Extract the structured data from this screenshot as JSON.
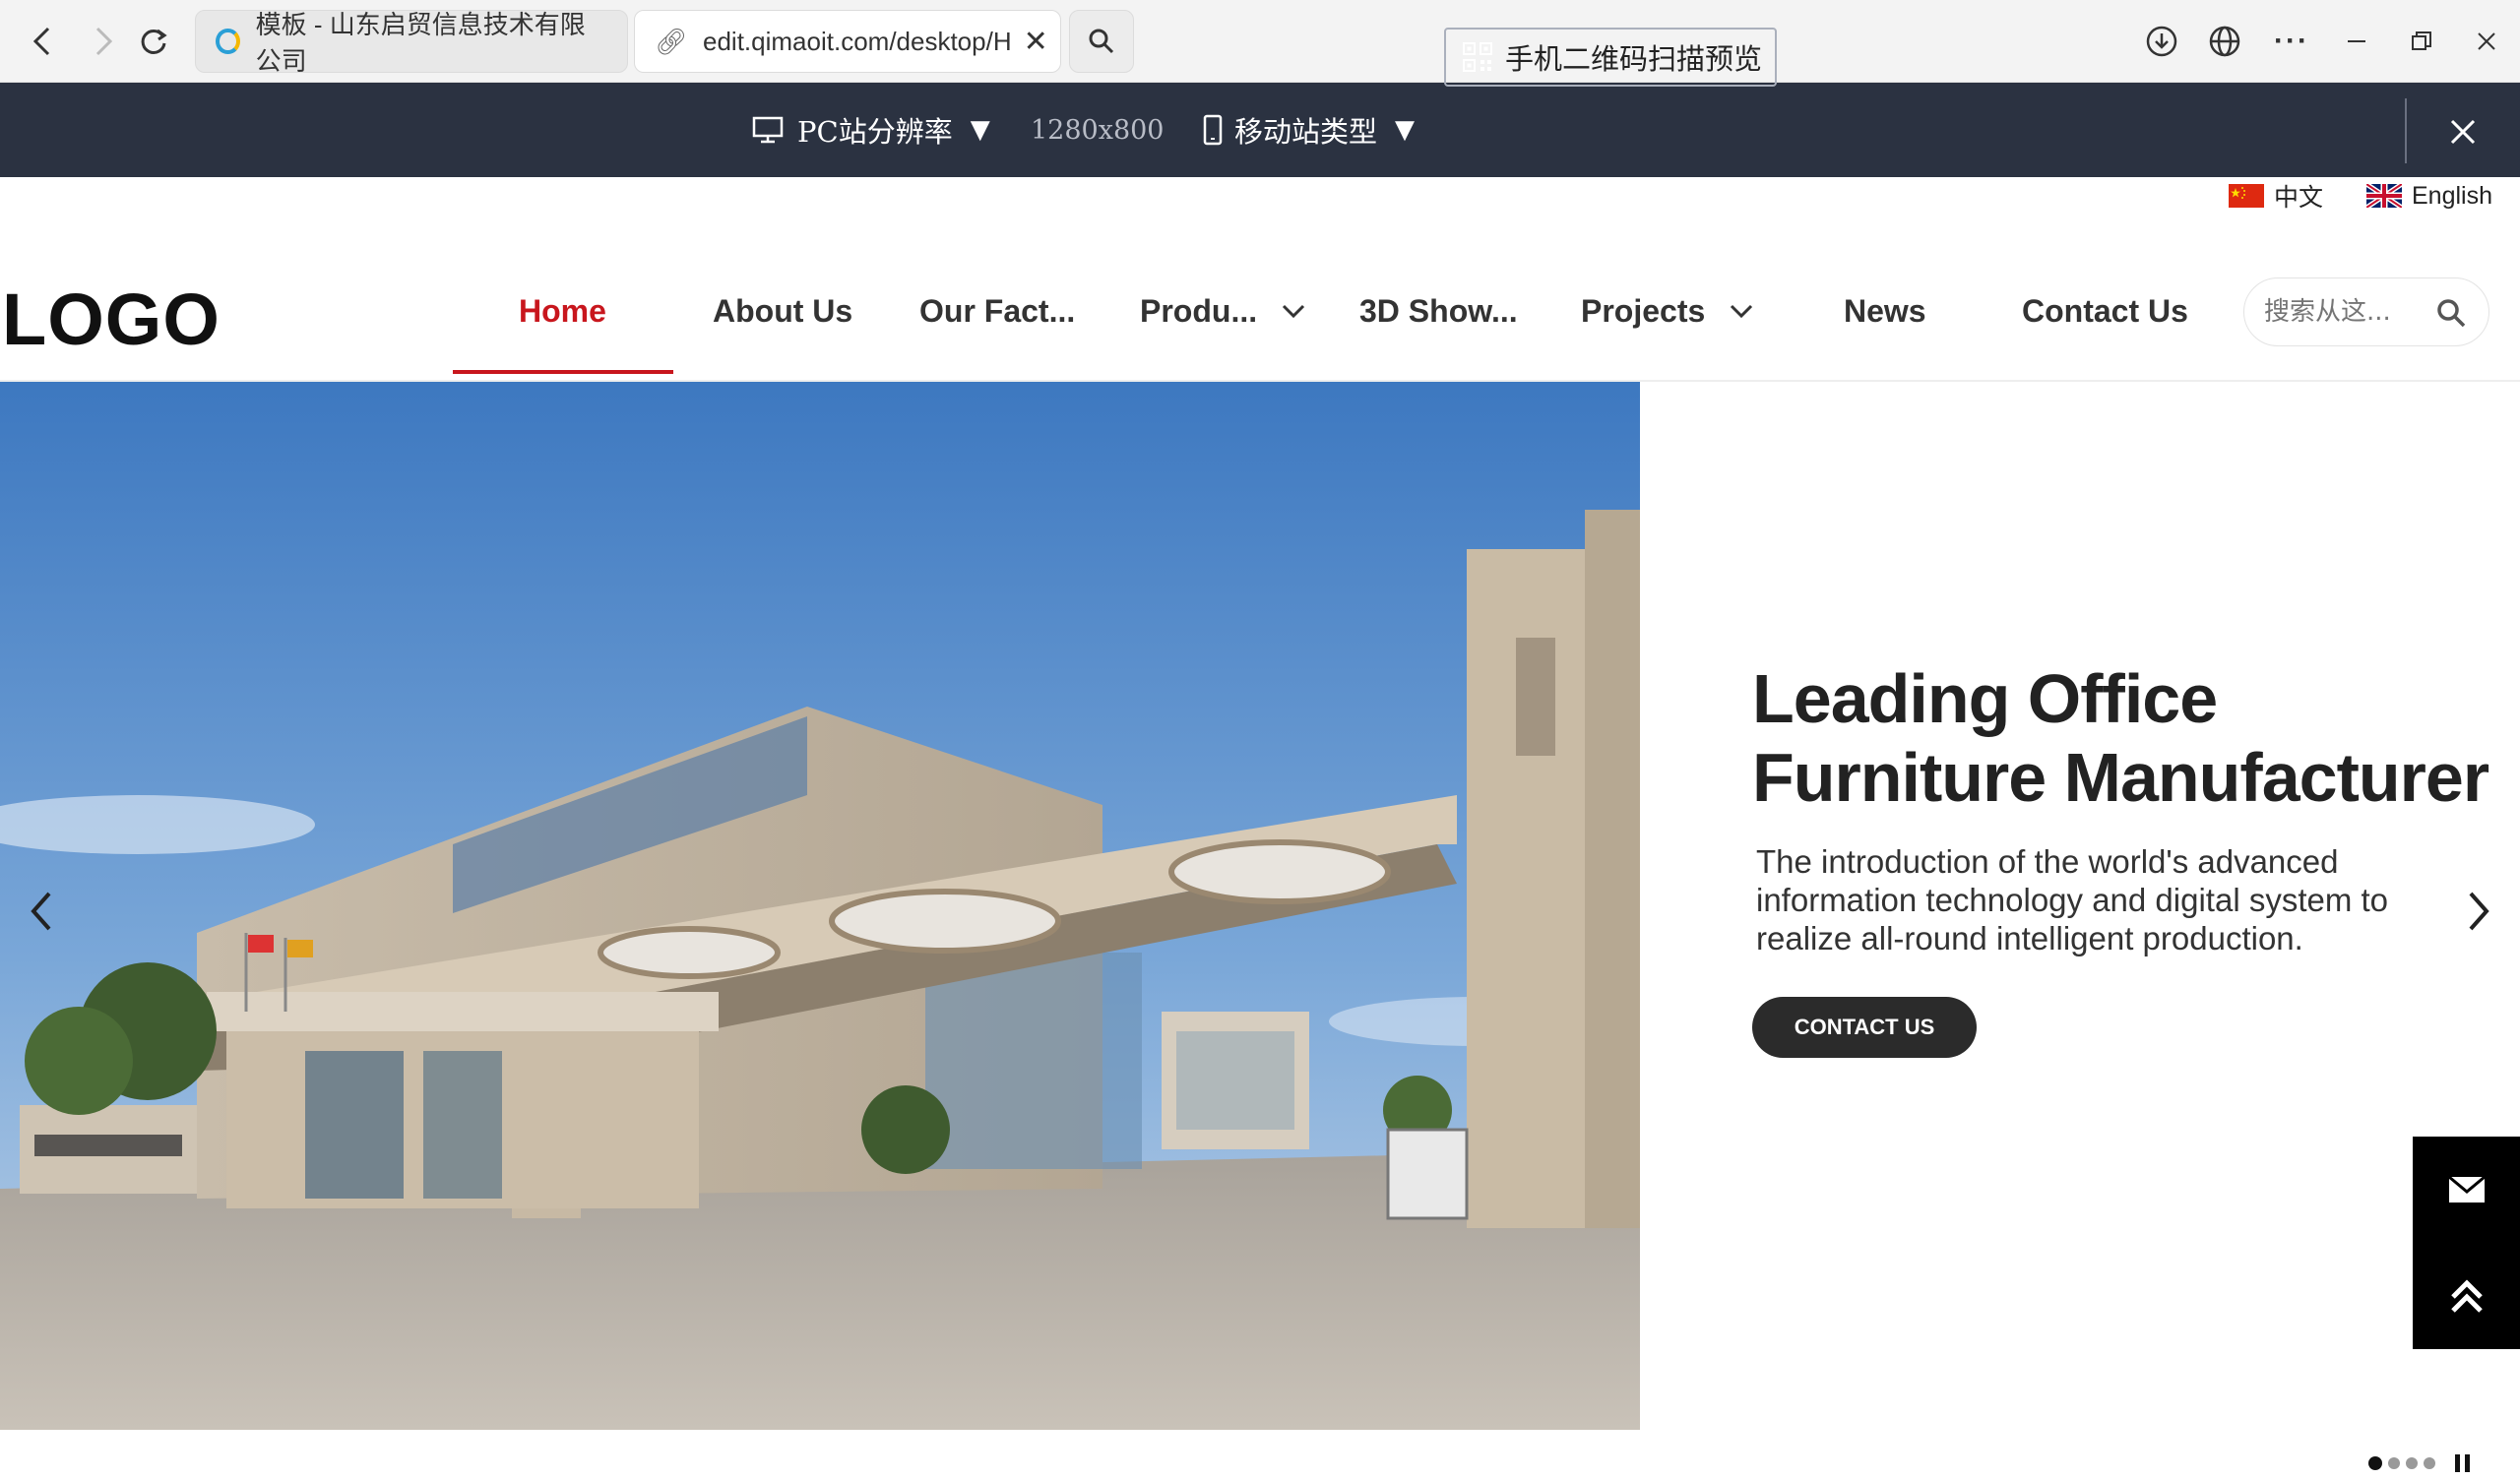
{
  "browser": {
    "tabs": [
      {
        "title": "模板 - 山东启贸信息技术有限公司",
        "active": false
      },
      {
        "title": "edit.qimaoit.com/desktop/H",
        "active": true
      }
    ]
  },
  "editor_toolbar": {
    "pc_resolution_label": "PC站分辨率",
    "resolution_value": "1280x800",
    "mobile_type_label": "移动站类型",
    "qr_preview_label": "手机二维码扫描预览"
  },
  "site": {
    "languages": [
      {
        "label": "中文",
        "flag": "cn-flag"
      },
      {
        "label": "English",
        "flag": "uk-flag"
      }
    ],
    "logo": "LOGO",
    "menu": [
      {
        "label": "Home",
        "active": true
      },
      {
        "label": "About Us"
      },
      {
        "label": "Our Fact..."
      },
      {
        "label": "Produ...",
        "dropdown": true
      },
      {
        "label": "3D Show..."
      },
      {
        "label": "Projects",
        "dropdown": true
      },
      {
        "label": "News"
      },
      {
        "label": "Contact Us"
      }
    ],
    "search_placeholder": "搜索从这...",
    "colors": {
      "accent": "#c8161d",
      "toolbar": "#2b3241"
    }
  },
  "hero": {
    "title": "Leading Office Furniture Manufacturer",
    "description": "The introduction of the world's advanced information technology and digital system to realize all-round intelligent production.",
    "button_label": "CONTACT US",
    "slides": 4,
    "current_slide": 1
  }
}
